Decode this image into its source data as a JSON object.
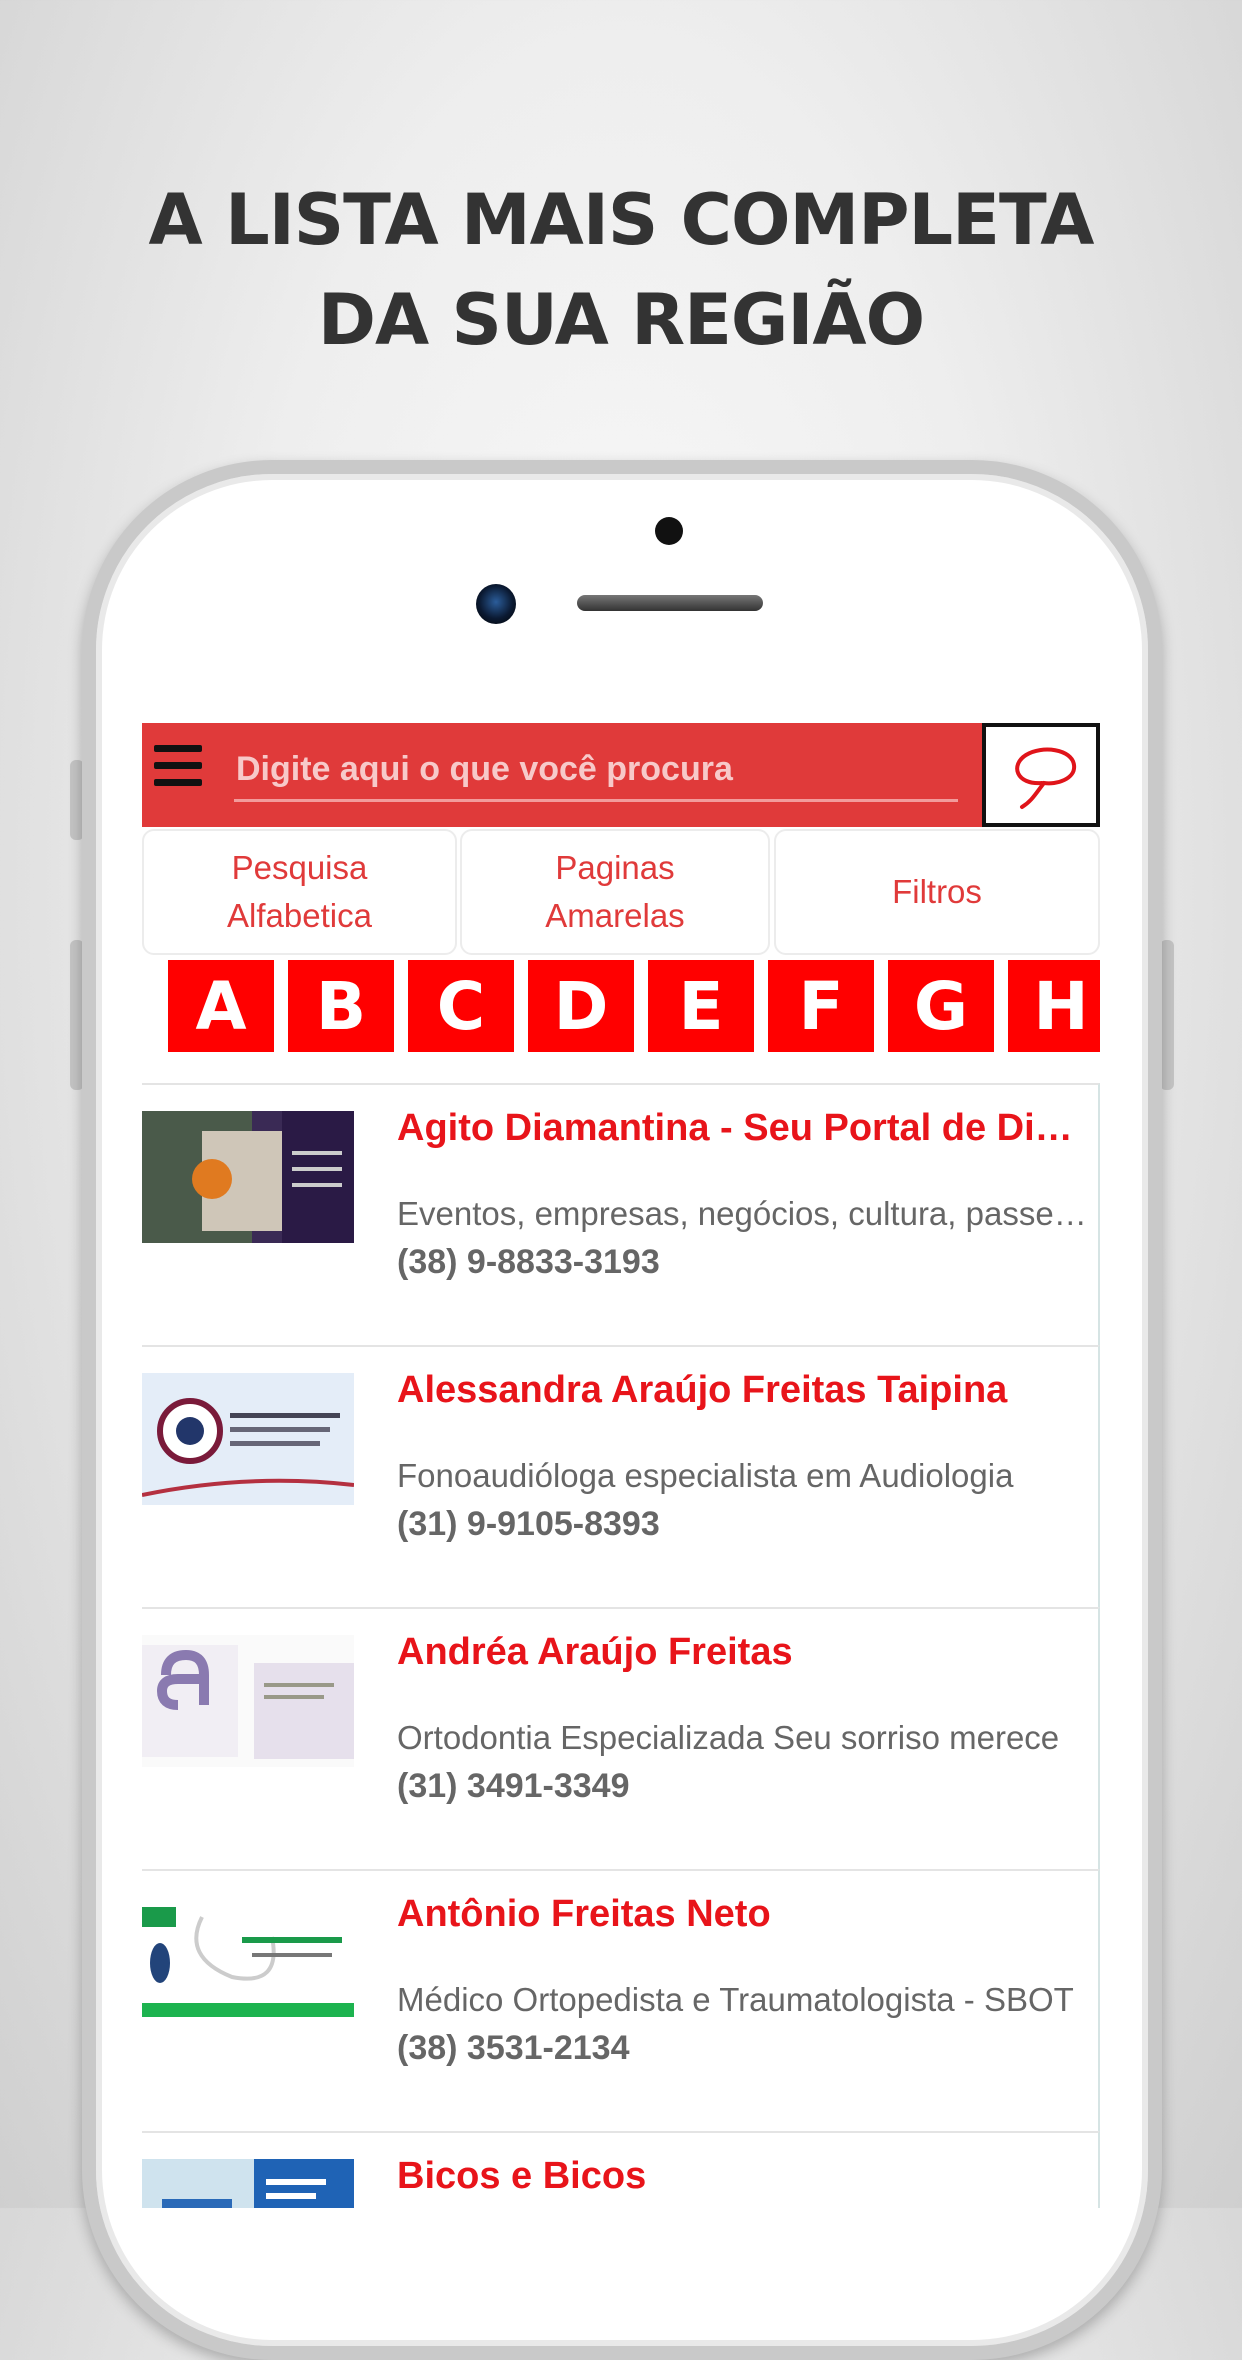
{
  "headline": {
    "line1": "A LISTA MAIS COMPLETA",
    "line2": "DA SUA REGIÃO"
  },
  "app": {
    "search": {
      "placeholder": "Digite aqui o que você procura",
      "value": ""
    },
    "icons": {
      "menu": "hamburger-menu-icon",
      "search_button": "lasso-icon"
    },
    "colors": {
      "brand_red": "#e03a3a",
      "letter_red": "#ff0000",
      "title_red": "#e8141a"
    },
    "tabs": [
      {
        "label_line1": "Pesquisa",
        "label_line2": "Alfabetica"
      },
      {
        "label_line1": "Paginas",
        "label_line2": "Amarelas"
      },
      {
        "label_line1": "Filtros",
        "label_line2": ""
      }
    ],
    "letters": [
      "A",
      "B",
      "C",
      "D",
      "E",
      "F",
      "G",
      "H"
    ],
    "listings": [
      {
        "title": "Agito Diamantina - Seu Portal de Diamantina",
        "description": "Eventos, empresas, negócios, cultura, passeios",
        "phone": "(38) 9-8833-3193"
      },
      {
        "title": "Alessandra Araújo Freitas Taipina",
        "description": "Fonoaudióloga especialista em Audiologia",
        "phone": "(31) 9-9105-8393"
      },
      {
        "title": "Andréa Araújo Freitas",
        "description": "Ortodontia Especializada Seu sorriso merece",
        "phone": "(31) 3491-3349"
      },
      {
        "title": "Antônio Freitas Neto",
        "description": "Médico Ortopedista e Traumatologista - SBOT",
        "phone": "(38) 3531-2134"
      },
      {
        "title": "Bicos e Bicos",
        "description": "",
        "phone": ""
      }
    ]
  }
}
